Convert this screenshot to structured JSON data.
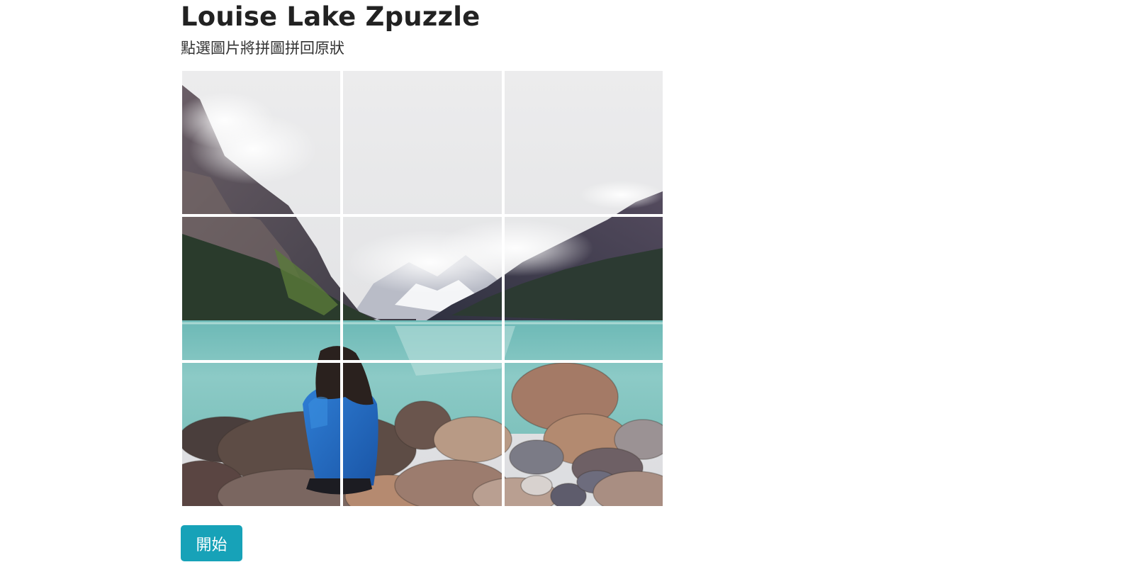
{
  "page": {
    "title": "Louise Lake Zpuzzle",
    "instruction": "點選圖片將拼圖拼回原狀"
  },
  "puzzle": {
    "grid": "3x3",
    "tiles": [
      {
        "label": "tile-1"
      },
      {
        "label": "tile-2"
      },
      {
        "label": "tile-3"
      },
      {
        "label": "tile-4"
      },
      {
        "label": "tile-5"
      },
      {
        "label": "tile-6"
      },
      {
        "label": "tile-7"
      },
      {
        "label": "tile-8"
      },
      {
        "label": "tile-9"
      }
    ]
  },
  "controls": {
    "start_label": "開始",
    "start_color": "#17a2b8"
  }
}
